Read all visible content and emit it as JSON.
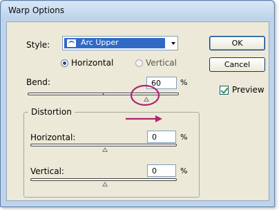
{
  "window": {
    "title": "Warp Options"
  },
  "style": {
    "label": "Style:",
    "selected": "Arc Upper",
    "icon": "arc-upper-icon"
  },
  "orientation": {
    "horizontal_label": "Horizontal",
    "vertical_label": "Vertical",
    "selected": "Horizontal"
  },
  "bend": {
    "label": "Bend:",
    "value": "60",
    "unit": "%"
  },
  "distortion": {
    "label": "Distortion",
    "horizontal": {
      "label": "Horizontal:",
      "value": "0",
      "unit": "%"
    },
    "vertical": {
      "label": "Vertical:",
      "value": "0",
      "unit": "%"
    }
  },
  "buttons": {
    "ok": "OK",
    "cancel": "Cancel"
  },
  "preview": {
    "label": "Preview",
    "checked": true
  },
  "annotations": {
    "highlight_color": "#b0226f",
    "icons": [
      "circle-highlight",
      "arrow-right"
    ]
  },
  "colors": {
    "title_bar": "#c6d9ef",
    "dialog_bg": "#ece9d8",
    "selection": "#316ac5"
  }
}
